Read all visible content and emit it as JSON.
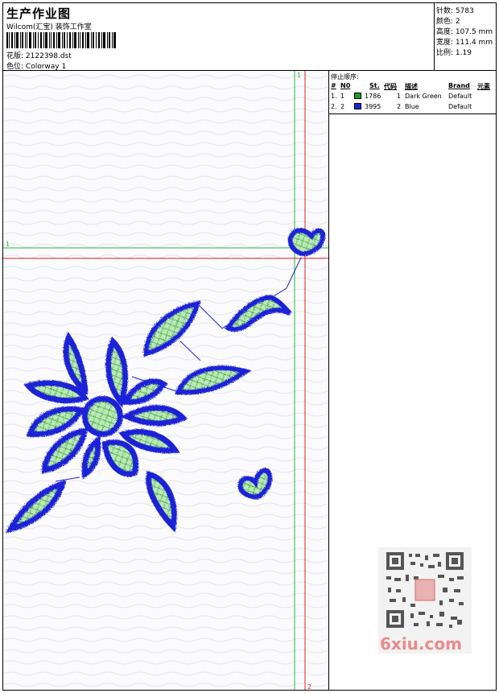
{
  "header": {
    "title": "生产作业图",
    "studio": "Wilcom(汇宝) 装饰工作室",
    "design_label": "花版:",
    "design_file": "2122398.dst",
    "colorway_label": "色位:",
    "colorway": "Colorway 1"
  },
  "stats": {
    "stitches_label": "针数:",
    "stitches": "5783",
    "colors_label": "颜色:",
    "colors": "2",
    "height_label": "高度:",
    "height": "107.5 mm",
    "width_label": "宽度:",
    "width": "111.4 mm",
    "scale_label": "比例:",
    "scale": "1.19"
  },
  "canvas": {
    "marker_top": "1",
    "marker_left": "1",
    "marker_bottom": "2"
  },
  "stop_sequence": {
    "title": "停止顺序:",
    "columns": [
      "#",
      "N0",
      "St.",
      "代码",
      "描述",
      "Brand",
      "元素"
    ],
    "rows": [
      {
        "idx": "1.",
        "n": "1",
        "color": "#1a9e2e",
        "st": "1786",
        "code": "1",
        "desc": "Dark Green",
        "brand": "Default"
      },
      {
        "idx": "2.",
        "n": "2",
        "color": "#1f24d6",
        "st": "3995",
        "code": "2",
        "desc": "Blue",
        "brand": "Default"
      }
    ]
  },
  "watermark": {
    "site": "6xiu.com"
  },
  "colors": {
    "blue": "#1f24d6",
    "green": "#1a9e2e",
    "red_guide": "#e02020",
    "green_guide": "#22bb33"
  }
}
